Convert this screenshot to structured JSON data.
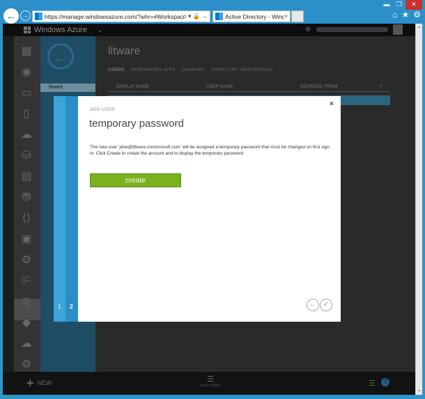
{
  "browser": {
    "url": "https://manage.windowsazure.com/?whr=#Workspaces/ActiveDi",
    "address_tools": "ρ ▾ 🔒 →",
    "tab_title": "Active Directory - Windows...",
    "tab_close": "×"
  },
  "portal": {
    "brand": "Windows Azure",
    "directory_title": "litware",
    "tabs": [
      "USERS",
      "INTEGRATED APPS",
      "DOMAINS",
      "DIRECTORY INTEGRATION"
    ],
    "sidebar_item": "litware",
    "columns": [
      "DISPLAY NAME",
      "USER NAME",
      "SOURCED FROM"
    ]
  },
  "command_bar": {
    "new_label": "NEW",
    "add_user_label": "ADD USER"
  },
  "dialog": {
    "kicker": "ADD USER",
    "title": "temporary password",
    "body": "The new user 'jdoe@litware.onmicrosoft.com' will be assigned a temporary password that must be changed on first sign in. Click Create to create the account and to display the temporary password.",
    "create_label": "create",
    "step1": "1",
    "step2": "2",
    "close": "×"
  },
  "colors": {
    "accent": "#2d8fca",
    "create_green": "#79b21c",
    "step_blue": "#3aa5d9"
  }
}
